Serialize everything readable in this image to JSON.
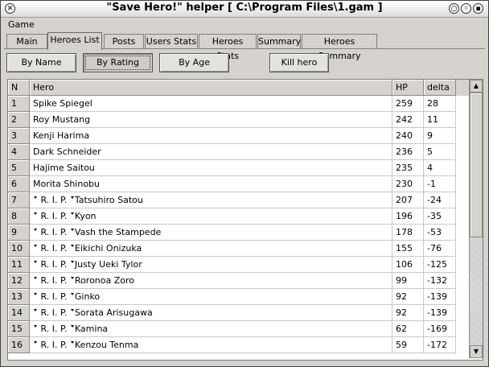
{
  "window": {
    "title": "\"Save Hero!\" helper [ C:\\Program Files\\1.gam ]"
  },
  "menu": {
    "items": [
      "Game"
    ]
  },
  "tabs": [
    "Main",
    "Heroes List",
    "Posts",
    "Users Stats",
    "Heroes Stats",
    "Summary",
    "Heroes Summary"
  ],
  "buttons": {
    "by_name": "By Name",
    "by_rating": "By Rating",
    "by_age": "By Age",
    "kill_hero": "Kill hero"
  },
  "table": {
    "headers": [
      "N",
      "Hero",
      "HP",
      "delta"
    ],
    "rip_label": "R. I. P.",
    "rows": [
      {
        "n": "1",
        "rip": false,
        "hero": "Spike Spiegel",
        "hp": "259",
        "delta": "28"
      },
      {
        "n": "2",
        "rip": false,
        "hero": "Roy Mustang",
        "hp": "242",
        "delta": "11"
      },
      {
        "n": "3",
        "rip": false,
        "hero": "Kenji Harima",
        "hp": "240",
        "delta": "9"
      },
      {
        "n": "4",
        "rip": false,
        "hero": "Dark Schneider",
        "hp": "236",
        "delta": "5"
      },
      {
        "n": "5",
        "rip": false,
        "hero": "Hajime Saitou",
        "hp": "235",
        "delta": "4"
      },
      {
        "n": "6",
        "rip": false,
        "hero": "Morita Shinobu",
        "hp": "230",
        "delta": "-1"
      },
      {
        "n": "7",
        "rip": true,
        "hero": "Tatsuhiro Satou",
        "hp": "207",
        "delta": "-24"
      },
      {
        "n": "8",
        "rip": true,
        "hero": "Kyon",
        "hp": "196",
        "delta": "-35"
      },
      {
        "n": "9",
        "rip": true,
        "hero": "Vash the Stampede",
        "hp": "178",
        "delta": "-53"
      },
      {
        "n": "10",
        "rip": true,
        "hero": "Eikichi Onizuka",
        "hp": "155",
        "delta": "-76"
      },
      {
        "n": "11",
        "rip": true,
        "hero": "Justy Ueki Tylor",
        "hp": "106",
        "delta": "-125"
      },
      {
        "n": "12",
        "rip": true,
        "hero": "Roronoa Zoro",
        "hp": "99",
        "delta": "-132"
      },
      {
        "n": "13",
        "rip": true,
        "hero": "Ginko",
        "hp": "92",
        "delta": "-139"
      },
      {
        "n": "14",
        "rip": true,
        "hero": "Sorata Arisugawa",
        "hp": "92",
        "delta": "-139"
      },
      {
        "n": "15",
        "rip": true,
        "hero": "Kamina",
        "hp": "62",
        "delta": "-169"
      },
      {
        "n": "16",
        "rip": true,
        "hero": "Kenzou Tenma",
        "hp": "59",
        "delta": "-172"
      }
    ]
  }
}
